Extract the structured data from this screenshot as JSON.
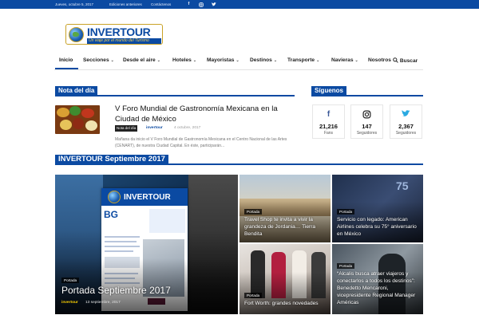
{
  "topbar": {
    "date": "Jueves, octubre 5, 2017",
    "link1": "Ediciones anteriores",
    "link2": "Contáctenos",
    "social_icons": [
      "facebook-icon",
      "instagram-icon",
      "twitter-icon"
    ]
  },
  "logo": {
    "name": "INVERTOUR",
    "tagline": "Un viaje por el mundo del Turismo"
  },
  "nav": {
    "items": [
      {
        "label": "Inicio"
      },
      {
        "label": "Secciones"
      },
      {
        "label": "Desde el aire"
      },
      {
        "label": "Hoteles"
      },
      {
        "label": "Mayoristas"
      },
      {
        "label": "Destinos"
      },
      {
        "label": "Transporte"
      },
      {
        "label": "Navieras"
      },
      {
        "label": "Nosotros"
      },
      {
        "label": "Buscar"
      }
    ],
    "active": "Inicio"
  },
  "nota": {
    "heading": "Nota del día",
    "title": "V Foro Mundial de Gastronomía Mexicana en la Ciudad de México",
    "category": "Nota del día",
    "author": "invertour",
    "date": "4 octubre, 2017",
    "excerpt": "Mañana da inicio el V Foro Mundial de Gastronomía Mexicana en el Centro Nacional de las Artes (CENART), de nuestra Ciudad Capital. En éste, participarán..."
  },
  "siguenos": {
    "heading": "Síguenos",
    "boxes": [
      {
        "icon": "facebook-icon",
        "glyph": "f",
        "count": "21,216",
        "label": "Fans",
        "color": "#3b5998"
      },
      {
        "icon": "instagram-icon",
        "glyph": "◎",
        "count": "147",
        "label": "Seguidores",
        "color": "#222222"
      },
      {
        "icon": "twitter-icon",
        "glyph": "🕊",
        "count": "2,367",
        "label": "Seguidores",
        "color": "#29a9e1"
      }
    ]
  },
  "edition": {
    "heading": "INVERTOUR Septiembre 2017",
    "main_tile": {
      "category": "Portada",
      "title": "Portada Septiembre 2017",
      "author": "invertour",
      "date": "13 septiembre, 2017",
      "magazine_name": "INVERTOUR"
    },
    "tiles": [
      {
        "category": "Portada",
        "title": "Travel Shop te invita a vivir la grandeza de Jordania… Tierra Bendita"
      },
      {
        "category": "Portada",
        "title": "Servicio con legado: American Airlines celebra su 75° aniversario en México"
      },
      {
        "category": "Portada",
        "title": "Fort Worth: grandes novedades"
      },
      {
        "category": "Portada",
        "title": "“Alcalis busca atraer viajeros y conectarlos a todos los destinos”: Benedetto Mencaroni, vicepresidente Regional Manager Américas"
      }
    ]
  },
  "colors": {
    "brand": "#0b4aa2",
    "accent_gold": "#c9a227"
  }
}
